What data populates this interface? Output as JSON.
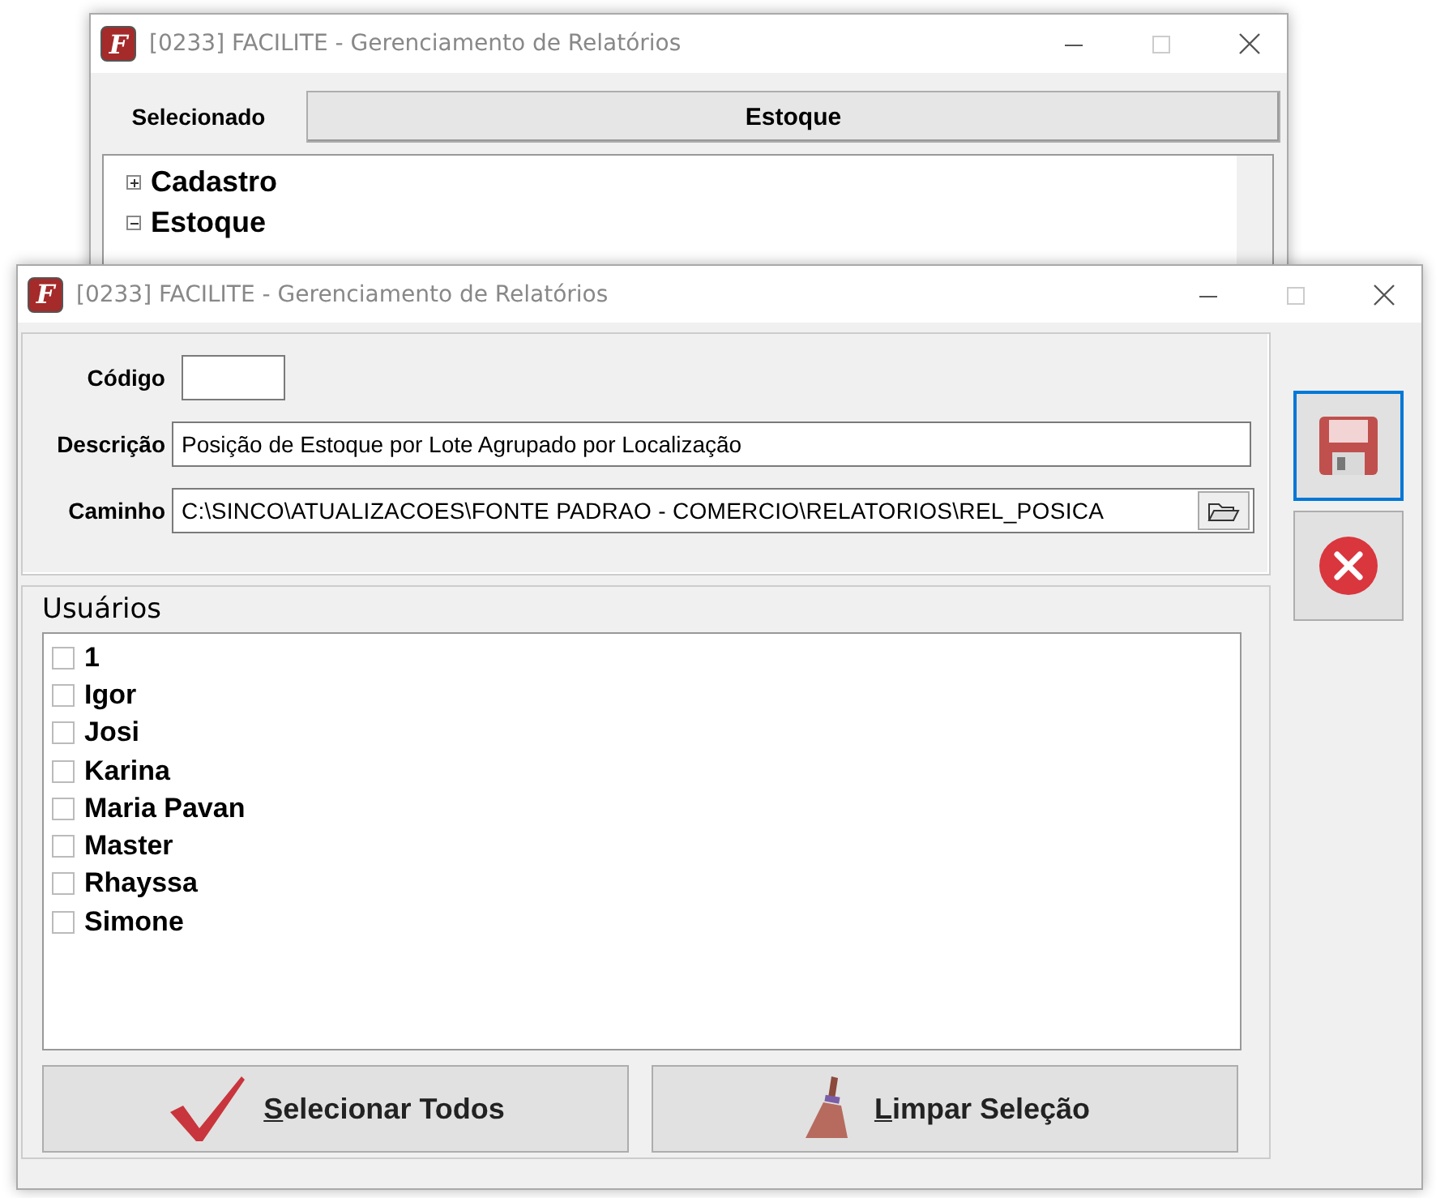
{
  "back_window": {
    "icon_letter": "F",
    "title": "[0233] FACILITE - Gerenciamento de Relatórios",
    "selected_label": "Selecionado",
    "selected_value": "Estoque",
    "tree": [
      {
        "label": "Cadastro",
        "expanded": false
      },
      {
        "label": "Estoque",
        "expanded": true
      }
    ]
  },
  "front_window": {
    "icon_letter": "F",
    "title": "[0233] FACILITE - Gerenciamento de Relatórios",
    "fields": [
      {
        "label": "Código",
        "kind": "short"
      },
      {
        "label": "Descrição",
        "value": "Posição de Estoque por Lote Agrupado por Localização",
        "kind": "text"
      },
      {
        "label": "Caminho",
        "value": "C:\\SINCO\\ATUALIZACOES\\FONTE PADRAO - COMERCIO\\RELATORIOS\\REL_POSICA",
        "kind": "browse"
      }
    ],
    "users_group": "Usuários",
    "users": [
      {
        "name": "1",
        "checked": false
      },
      {
        "name": "Igor",
        "checked": false
      },
      {
        "name": "Josi",
        "checked": false
      },
      {
        "name": "Karina",
        "checked": false
      },
      {
        "name": "Maria Pavan",
        "checked": false
      },
      {
        "name": "Master",
        "checked": false
      },
      {
        "name": "Rhayssa",
        "checked": false
      },
      {
        "name": "Simone",
        "checked": false
      }
    ],
    "buttons": [
      {
        "label": "Selecionar Todos",
        "kind": "select_all",
        "mnemonic": true
      },
      {
        "label": "Limpar Seleção",
        "kind": "clear",
        "mnemonic": true
      }
    ],
    "side_buttons": [
      {
        "kind": "save",
        "focused": true
      },
      {
        "kind": "cancel",
        "focused": false
      }
    ]
  }
}
